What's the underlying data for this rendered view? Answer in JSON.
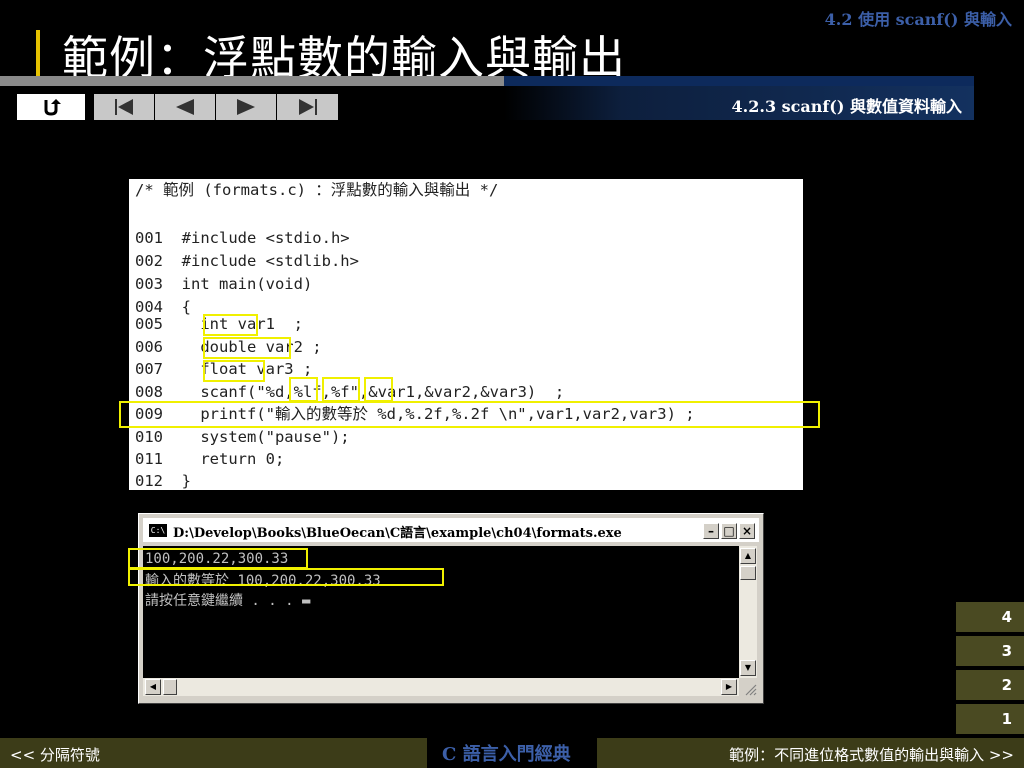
{
  "header": {
    "section_label": "4.2  使用 scanf() 與輸入",
    "title": "範例：浮點數的輸入與輸出",
    "subsection": "4.2.3 scanf() 與數值資料輸入"
  },
  "nav": [
    "return-icon",
    "first-icon",
    "prev-icon",
    "next-icon",
    "last-icon"
  ],
  "code": {
    "comment": "/* 範例 (formats.c) ：浮點數的輸入與輸出 */",
    "lines": [
      "001  #include <stdio.h>",
      "002  #include <stdlib.h>",
      "003  int main(void)",
      "004  {",
      "005    int var1  ;",
      "006    double var2 ;",
      "007    float var3 ;",
      "008    scanf(\"%d,%lf,%f\",&var1,&var2,&var3)  ;",
      "009    printf(\"輸入的數等於 %d,%.2f,%.2f \\n\",var1,var2,var3) ;",
      "010    system(\"pause\");",
      "011    return 0;",
      "012  }"
    ]
  },
  "console": {
    "title": "D:\\Develop\\Books\\BlueOecan\\C語言\\example\\ch04\\formats.exe",
    "icon_text": "C:\\",
    "lines": [
      "100,200.22,300.33",
      "輸入的數等於 100,200.22,300.33",
      "請按任意鍵繼續 . . . ▬"
    ],
    "min": "–",
    "max": "□",
    "close": "×"
  },
  "pages": [
    "4",
    "3",
    "2",
    "1"
  ],
  "footer": {
    "prev": "<< 分隔符號",
    "book": "C 語言入門經典",
    "next": "範例：不同進位格式數值的輸出與輸入 >>"
  },
  "colors": {
    "highlight": "#f0f000",
    "accent": "#3c5fa8",
    "footer_bg": "#3c3c18",
    "tab_bg": "#4a4a22"
  }
}
